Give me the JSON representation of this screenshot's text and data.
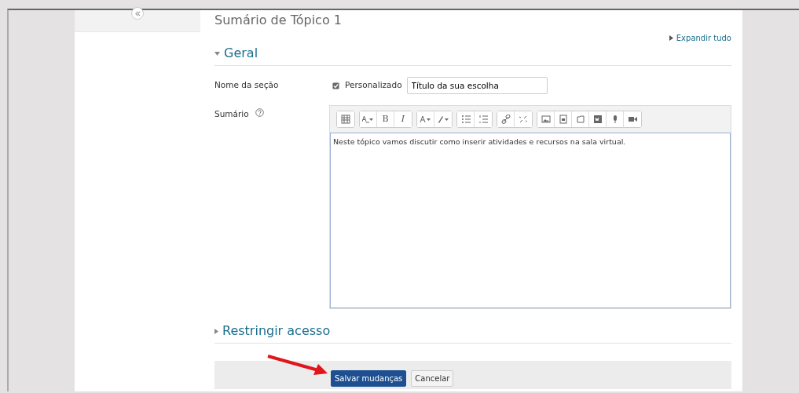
{
  "page_title": "Sumário de Tópico 1",
  "expand_all": "Expandir tudo",
  "sections": [
    {
      "title": "Geral",
      "expanded": true
    },
    {
      "title": "Restringir acesso",
      "expanded": false
    }
  ],
  "section_name": {
    "label": "Nome da seção",
    "checkbox_label": "Personalizado",
    "checked": true,
    "value": "Título da sua escolha"
  },
  "summary": {
    "label": "Sumário",
    "toolbar_texts": [
      "B",
      "I"
    ],
    "content": "Neste tópico vamos discutir como inserir atividades e recursos na sala virtual."
  },
  "buttons": [
    {
      "label": "Salvar mudanças",
      "kind": "primary"
    },
    {
      "label": "Cancelar",
      "kind": "secondary"
    }
  ]
}
